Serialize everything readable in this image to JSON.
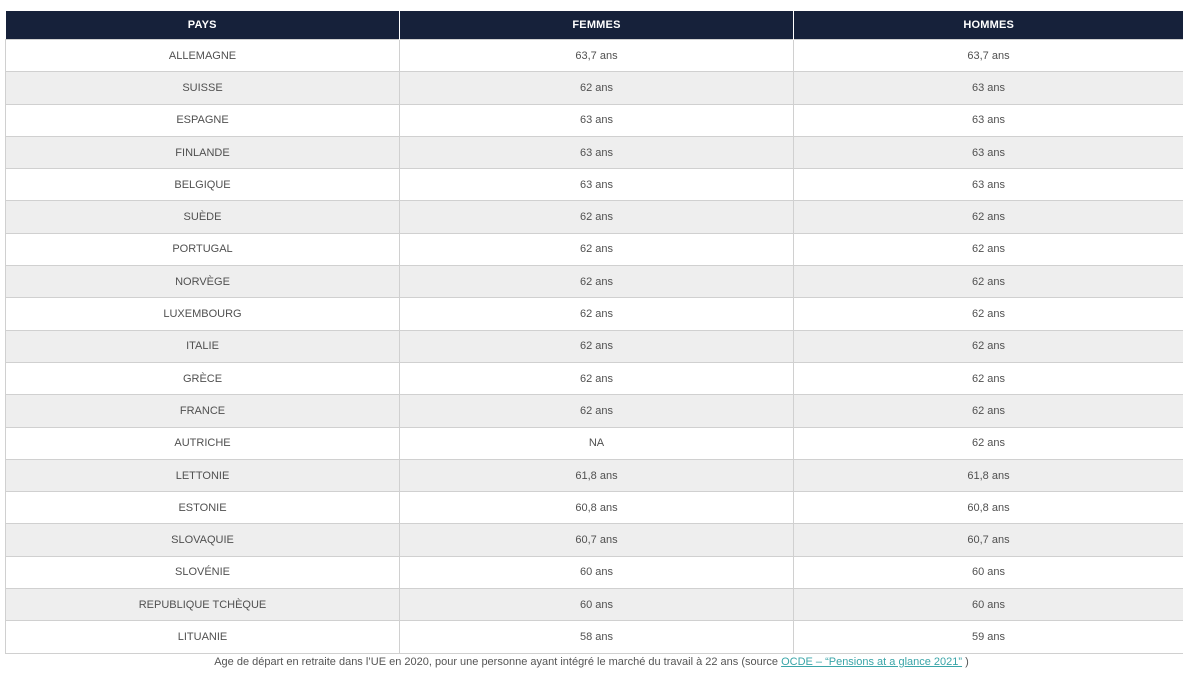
{
  "table": {
    "headers": [
      "PAYS",
      "FEMMES",
      "HOMMES"
    ],
    "rows": [
      [
        "ALLEMAGNE",
        "63,7 ans",
        "63,7 ans"
      ],
      [
        "SUISSE",
        "62 ans",
        "63 ans"
      ],
      [
        "ESPAGNE",
        "63 ans",
        "63 ans"
      ],
      [
        "FINLANDE",
        "63 ans",
        "63 ans"
      ],
      [
        "BELGIQUE",
        "63 ans",
        "63 ans"
      ],
      [
        "SUÈDE",
        "62 ans",
        "62 ans"
      ],
      [
        "PORTUGAL",
        "62 ans",
        "62 ans"
      ],
      [
        "NORVÈGE",
        "62 ans",
        "62 ans"
      ],
      [
        "LUXEMBOURG",
        "62 ans",
        "62 ans"
      ],
      [
        "ITALIE",
        "62 ans",
        "62 ans"
      ],
      [
        "GRÈCE",
        "62 ans",
        "62 ans"
      ],
      [
        "FRANCE",
        "62 ans",
        "62 ans"
      ],
      [
        "AUTRICHE",
        "NA",
        "62 ans"
      ],
      [
        "LETTONIE",
        "61,8 ans",
        "61,8 ans"
      ],
      [
        "ESTONIE",
        "60,8 ans",
        "60,8 ans"
      ],
      [
        "SLOVAQUIE",
        "60,7 ans",
        "60,7 ans"
      ],
      [
        "SLOVÉNIE",
        "60 ans",
        "60 ans"
      ],
      [
        "REPUBLIQUE TCHÈQUE",
        "60 ans",
        "60 ans"
      ],
      [
        "LITUANIE",
        "58 ans",
        "59 ans"
      ]
    ]
  },
  "caption": {
    "text": "Age de départ en retraite dans l’UE en 2020, pour une personne ayant intégré le marché du travail à 22 ans (source ",
    "link_text": "OCDE – “Pensions at a glance 2021”",
    "suffix": " )"
  },
  "colors": {
    "header_bg": "#16213a",
    "header_text": "#ffffff",
    "stripe": "#eeeeee",
    "link": "#3aa5a8"
  }
}
